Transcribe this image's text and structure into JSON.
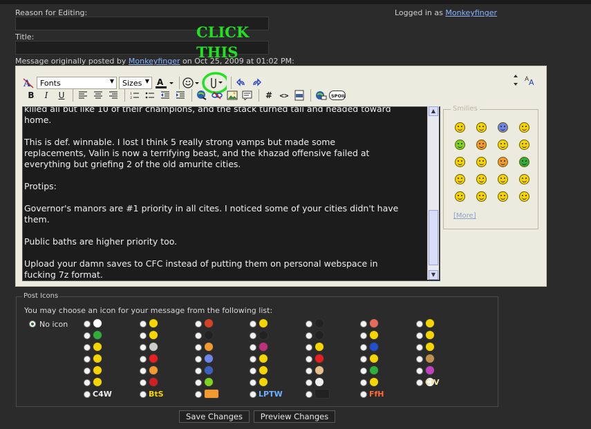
{
  "form": {
    "reason_label": "Reason for Editing:",
    "title_label": "Title:",
    "logged_in_prefix": "Logged in as",
    "username": "Monkeyfinger",
    "orig_prefix": "Message originally posted by",
    "orig_author": "Monkeyfinger",
    "orig_date": "on Oct 25, 2009 at 01:02 PM:"
  },
  "annotation": {
    "line1": "CLICK",
    "line2": "THIS",
    "color": "#22e022"
  },
  "toolbar": {
    "font_select": "Fonts",
    "size_select": "Sizes",
    "icons_row1": [
      "remove-format-icon",
      "font-color-icon",
      "smilie-menu-icon",
      "attach-icon",
      "undo-icon",
      "redo-icon"
    ],
    "icons_row2": [
      "bold",
      "italic",
      "underline",
      "align-left",
      "align-center",
      "align-right",
      "ordered-list",
      "unordered-list",
      "outdent",
      "indent",
      "link",
      "unlink",
      "image",
      "quote",
      "code",
      "html",
      "php",
      "email",
      "spoiler"
    ],
    "bold": "B",
    "italic": "I",
    "underline": "U",
    "code_hash": "#",
    "html_tag": "<>",
    "spoil": "SPOIL",
    "php": "PHP"
  },
  "message": {
    "lines": [
      "killed all but like 10 of their champions, and the stack turned tail and headed toward",
      "home.",
      "",
      "This is def. winnable. I lost I think 5 really strong vamps but made some",
      "replacements, Valin is now a terrifying beast, and the khazad offensive failed at",
      "everything but griefing 2 of the old amurite cities.",
      "",
      "Protips:",
      "",
      "Governor's manors are #1 priority in all cites. I noticed some of your cities didn't have",
      "them.",
      "",
      "Public baths are higher priority too.",
      "",
      "Upload your damn saves to CFC instead of putting them on personal webspace in",
      "fucking 7z format."
    ]
  },
  "smilies": {
    "legend": "Smilies",
    "more": "[More]",
    "colors": [
      "#f5d400",
      "#f5d400",
      "#6f86e8",
      "#f5d400",
      "#7ed321",
      "#f09a30",
      "#f5d400",
      "#f5d400",
      "#f5d400",
      "#f5d400",
      "#f09a30",
      "#2fae3a",
      "#f5d400",
      "#f5d400",
      "#f5d400",
      "#f5d400",
      "#f5d400",
      "#f5d400",
      "#f5d400",
      "#f5d400"
    ]
  },
  "post_icons": {
    "legend": "Post Icons",
    "instructions": "You may choose an icon for your message from the following list:",
    "no_icon": "No icon",
    "text_icons": [
      "CIV",
      "C4W",
      "BtS",
      "LPTW",
      "FfH"
    ],
    "icon_colors": [
      [
        "#ffffff",
        "#f5d400",
        "#d8402a",
        "#f5d400",
        "#222222",
        "#e86a5a",
        "#f5d400"
      ],
      [
        "#2fae3a",
        "#f5d400",
        "#222222",
        "#222222",
        "#222222",
        "#f5d400",
        "#f5d400"
      ],
      [
        "#f5d400",
        "#cccccc",
        "#f09a30",
        "#c0307a",
        "#f5d400",
        "#2050d0",
        "#f5d400"
      ],
      [
        "#f5d400",
        "#e82020",
        "#6f86e8",
        "#f5d400",
        "#e82020",
        "#f5d400",
        "#c09050"
      ],
      [
        "#f5d400",
        "#f09a30",
        "#4060c0",
        "#f5d400",
        "#e8c090",
        "#2fae3a",
        "#c040c0"
      ],
      [
        "#f5d400",
        "#d02020",
        "#7ed321",
        "#f5d400",
        "#f0f0f0",
        "#f5d400",
        "#ffffff"
      ]
    ]
  },
  "buttons": {
    "save": "Save Changes",
    "preview": "Preview Changes"
  }
}
